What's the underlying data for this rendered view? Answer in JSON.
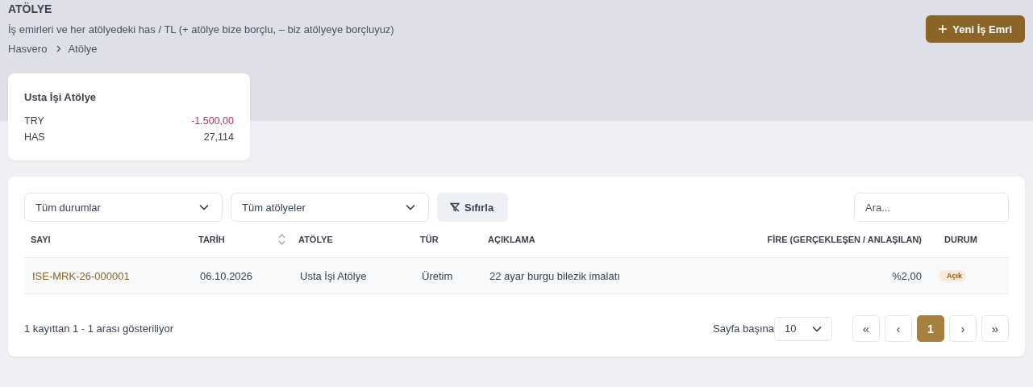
{
  "page": {
    "title": "ATÖLYE",
    "subtitle": "İş emirleri ve her atölyedeki has / TL (+ atölye bize borçlu, – biz atölyeye borçluyuz)",
    "breadcrumb": [
      "Hasvero",
      "Atölye"
    ],
    "action_button": "Yeni İş Emri"
  },
  "balance_cards": [
    {
      "title": "Usta İşi Atölye",
      "rows": [
        {
          "label": "TRY",
          "value": "-1.500,00",
          "negative": true
        },
        {
          "label": "HAS",
          "value": "27,114",
          "negative": false
        }
      ]
    }
  ],
  "filters": {
    "status": "Tüm durumlar",
    "workshop": "Tüm atölyeler",
    "reset_button": "Sıfırla",
    "search": {
      "placeholder": "Ara..."
    }
  },
  "table": {
    "columns": [
      {
        "label": "SAYI",
        "sortable": false
      },
      {
        "label": "TARİH",
        "sortable": true
      },
      {
        "label": "ATÖLYE",
        "sortable": false
      },
      {
        "label": "TÜR",
        "sortable": false
      },
      {
        "label": "AÇIKLAMA",
        "sortable": false
      },
      {
        "label": "FİRE (GERÇEKLEŞEN / ANLAŞILAN)",
        "sortable": false
      },
      {
        "label": "DURUM",
        "sortable": false
      }
    ],
    "rows": [
      {
        "number": "ISE-MRK-26-000001",
        "date": "06.10.2026",
        "workshop": "Usta İşi Atölye",
        "type": "Üretim",
        "description": "22 ayar burgu bilezik imalatı",
        "wastage": "%2,00",
        "status": "Açık"
      }
    ]
  },
  "footer": {
    "summary": "1 kayıttan 1 - 1 arası gösteriliyor",
    "per_page_label": "Sayfa başına",
    "per_page": "10",
    "pages": [
      {
        "label": "«",
        "kind": "first",
        "selected": false
      },
      {
        "label": "‹",
        "kind": "prev",
        "selected": false
      },
      {
        "label": "1",
        "kind": "page",
        "selected": true
      },
      {
        "label": "›",
        "kind": "next",
        "selected": false
      },
      {
        "label": "»",
        "kind": "last",
        "selected": false
      }
    ]
  }
}
